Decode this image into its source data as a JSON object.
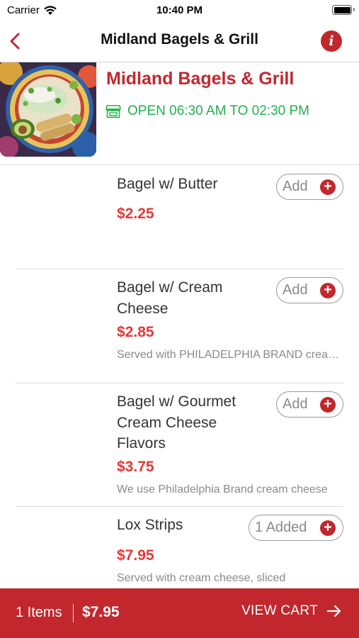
{
  "status_bar": {
    "carrier": "Carrier",
    "time": "10:40 PM",
    "battery_level": 1.0,
    "icons": [
      "wifi-icon",
      "battery-icon"
    ]
  },
  "nav": {
    "title": "Midland Bagels & Grill",
    "back_icon": "chevron-left-icon",
    "info_icon": "info-icon",
    "info_glyph": "i"
  },
  "restaurant": {
    "name": "Midland Bagels & Grill",
    "hours": "OPEN 06:30 AM TO 02:30 PM",
    "store_icon": "store-icon",
    "image": "food-plate-photo"
  },
  "menu": {
    "items": [
      {
        "name": "Bagel w/ Butter",
        "price": "$2.25",
        "description": "",
        "button_label": "Add"
      },
      {
        "name": "Bagel w/ Cream Cheese",
        "price": "$2.85",
        "description": "Served with PHILADELPHIA BRAND cream cheese",
        "button_label": "Add"
      },
      {
        "name": "Bagel w/ Gourmet Cream Cheese Flavors",
        "price": "$3.75",
        "description": "We use Philadelphia Brand cream cheese",
        "button_label": "Add"
      },
      {
        "name": "Lox Strips",
        "price": "$7.95",
        "description": "Served with cream cheese, sliced",
        "button_label": "1 Added"
      }
    ]
  },
  "cart": {
    "count_label": "1 Items",
    "total": "$7.95",
    "view_cart_label": "VIEW CART",
    "arrow_icon": "arrow-right-icon"
  },
  "colors": {
    "brand_red": "#c1272d",
    "price_red": "#e53935",
    "open_green": "#22b04b",
    "muted_gray": "#8a8a8a"
  }
}
